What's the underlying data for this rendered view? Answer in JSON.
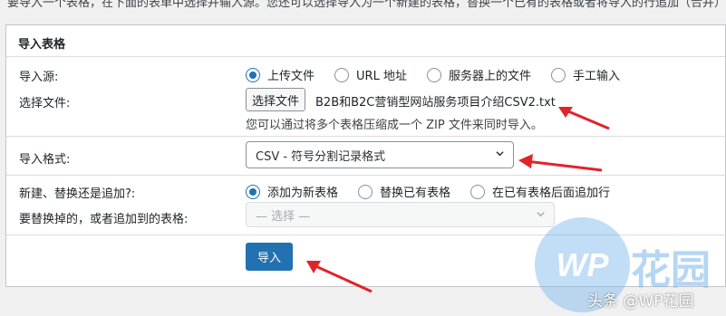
{
  "intro": "要导入一个表格，在下面的表单中选择并输入源。您还可以选择导入为一个新建的表格，替换一个已有的表格或者将导入的行追加（合并）",
  "panel": {
    "title": "导入表格",
    "source": {
      "label": "导入源:",
      "options": [
        "上传文件",
        "URL 地址",
        "服务器上的文件",
        "手工输入"
      ],
      "selected": "上传文件"
    },
    "file": {
      "label": "选择文件:",
      "button": "选择文件",
      "filename": "B2B和B2C营销型网站服务项目介绍CSV2.txt",
      "hint": "您可以通过将多个表格压缩成一个 ZIP 文件来同时导入。"
    },
    "format": {
      "label": "导入格式:",
      "value": "CSV - 符号分割记录格式"
    },
    "mode": {
      "label": "新建、替换还是追加?:",
      "options": [
        "添加为新表格",
        "替换已有表格",
        "在已有表格后面追加行"
      ],
      "selected": "添加为新表格"
    },
    "target": {
      "label": "要替换掉的，或者追加到的表格:",
      "placeholder": "— 选择 —"
    },
    "submit": "导入"
  },
  "watermark": {
    "logo_text": "WP",
    "cn_text": "花园",
    "credit": "头条 @WP花园"
  },
  "colors": {
    "accent": "#2271b1",
    "arrow": "#e0242a"
  }
}
